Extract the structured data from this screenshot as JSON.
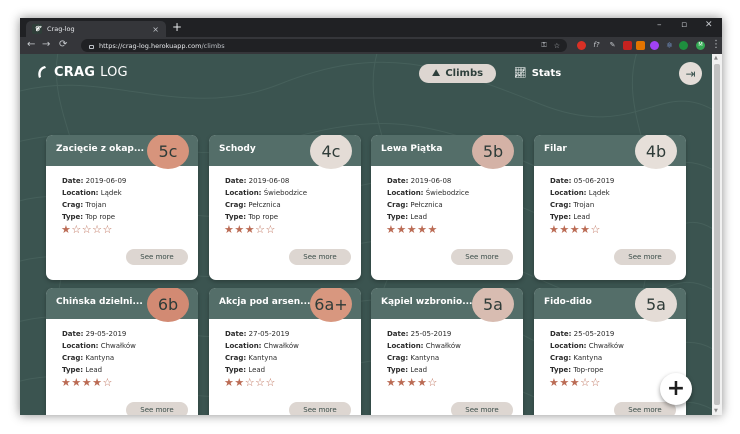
{
  "browser": {
    "tab_title": "Crag-log",
    "tab_close": "×",
    "new_tab": "+",
    "url_host": "https://crag-log.herokuapp.com",
    "url_path": "/climbs",
    "win_min": "–",
    "win_max": "▫",
    "win_close": "✕",
    "back": "←",
    "forward": "→",
    "reload": "⟳",
    "key_icon": "⚿",
    "star_icon": "☆",
    "menu_icon": "⋮"
  },
  "app": {
    "logo_bold": "CRAG",
    "logo_light": "LOG",
    "nav_climbs": "Climbs",
    "nav_stats": "Stats",
    "accent": "#3b5450"
  },
  "cards": [
    {
      "title": "Zacięcie z okap...",
      "grade": "5c",
      "grade_color": "#d7947c",
      "date_label": "Date:",
      "date": "2019-06-09",
      "location_label": "Location:",
      "location": "Lądek",
      "crag_label": "Crag:",
      "crag": "Trojan",
      "type_label": "Type:",
      "type": "Top rope",
      "rating": 1,
      "see_more": "See more"
    },
    {
      "title": "Schody",
      "grade": "4c",
      "grade_color": "#e4dcd6",
      "date_label": "Date:",
      "date": "2019-06-08",
      "location_label": "Location:",
      "location": "Świebodzice",
      "crag_label": "Crag:",
      "crag": "Pełcznica",
      "type_label": "Type:",
      "type": "Top rope",
      "rating": 3,
      "see_more": "See more"
    },
    {
      "title": "Lewa Piątka",
      "grade": "5b",
      "grade_color": "#d4b2a6",
      "date_label": "Date:",
      "date": "2019-06-08",
      "location_label": "Location:",
      "location": "Świebodzice",
      "crag_label": "Crag:",
      "crag": "Pełcznica",
      "type_label": "Type:",
      "type": "Lead",
      "rating": 5,
      "see_more": "See more"
    },
    {
      "title": "Filar",
      "grade": "4b",
      "grade_color": "#e6dfd9",
      "date_label": "Date:",
      "date": "05-06-2019",
      "location_label": "Location:",
      "location": "Lądek",
      "crag_label": "Crag:",
      "crag": "Trojan",
      "type_label": "Type:",
      "type": "Lead",
      "rating": 4,
      "see_more": "See more"
    },
    {
      "title": "Chińska dzielni...",
      "grade": "6b",
      "grade_color": "#d28a73",
      "date_label": "Date:",
      "date": "29-05-2019",
      "location_label": "Location:",
      "location": "Chwałków",
      "crag_label": "Crag:",
      "crag": "Kantyna",
      "type_label": "Type:",
      "type": "Lead",
      "rating": 4,
      "see_more": "See more"
    },
    {
      "title": "Akcja pod arsen...",
      "grade": "6a+",
      "grade_color": "#d8977f",
      "date_label": "Date:",
      "date": "27-05-2019",
      "location_label": "Location:",
      "location": "Chwałków",
      "crag_label": "Crag:",
      "crag": "Kantyna",
      "type_label": "Type:",
      "type": "Lead",
      "rating": 2,
      "see_more": "See more"
    },
    {
      "title": "Kąpiel wzbronio...",
      "grade": "5a",
      "grade_color": "#d8bcb1",
      "date_label": "Date:",
      "date": "25-05-2019",
      "location_label": "Location:",
      "location": "Chwałków",
      "crag_label": "Crag:",
      "crag": "Kantyna",
      "type_label": "Type:",
      "type": "Lead",
      "rating": 4,
      "see_more": "See more"
    },
    {
      "title": "Fido-dido",
      "grade": "5a",
      "grade_color": "#e4dcd6",
      "date_label": "Date:",
      "date": "25-05-2019",
      "location_label": "Location:",
      "location": "Chwałków",
      "crag_label": "Crag:",
      "crag": "Kantyna",
      "type_label": "Type:",
      "type": "Top-rope",
      "rating": 3,
      "see_more": "See more"
    }
  ],
  "fab_label": "+"
}
